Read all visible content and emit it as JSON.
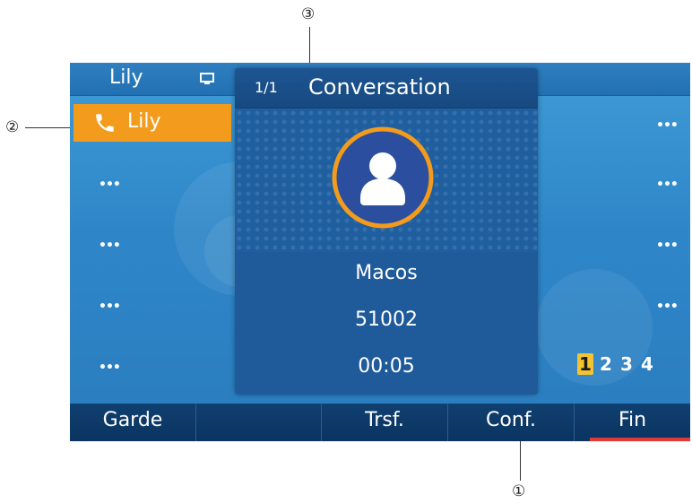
{
  "callouts": {
    "one": "①",
    "two": "②",
    "three": "③"
  },
  "topbar": {
    "account_name": "Lily",
    "icon": "monitor-icon"
  },
  "line_key": {
    "label": "Lily",
    "icon": "phone-icon"
  },
  "more_dots": "•••",
  "call": {
    "count": "1/1",
    "title": "Conversation",
    "caller_name": "Macos",
    "number": "51002",
    "duration": "00:05"
  },
  "pages": [
    "1",
    "2",
    "3",
    "4"
  ],
  "active_page": "1",
  "softkeys": [
    {
      "label": "Garde"
    },
    {
      "label": ""
    },
    {
      "label": "Trsf."
    },
    {
      "label": "Conf."
    },
    {
      "label": "Fin"
    }
  ],
  "colors": {
    "line_key_active": "#f29b1c",
    "screen_bg": "#2e86c8",
    "end_call": "#e53935",
    "page_active": "#f4c430",
    "avatar_ring": "#f29b1c"
  }
}
